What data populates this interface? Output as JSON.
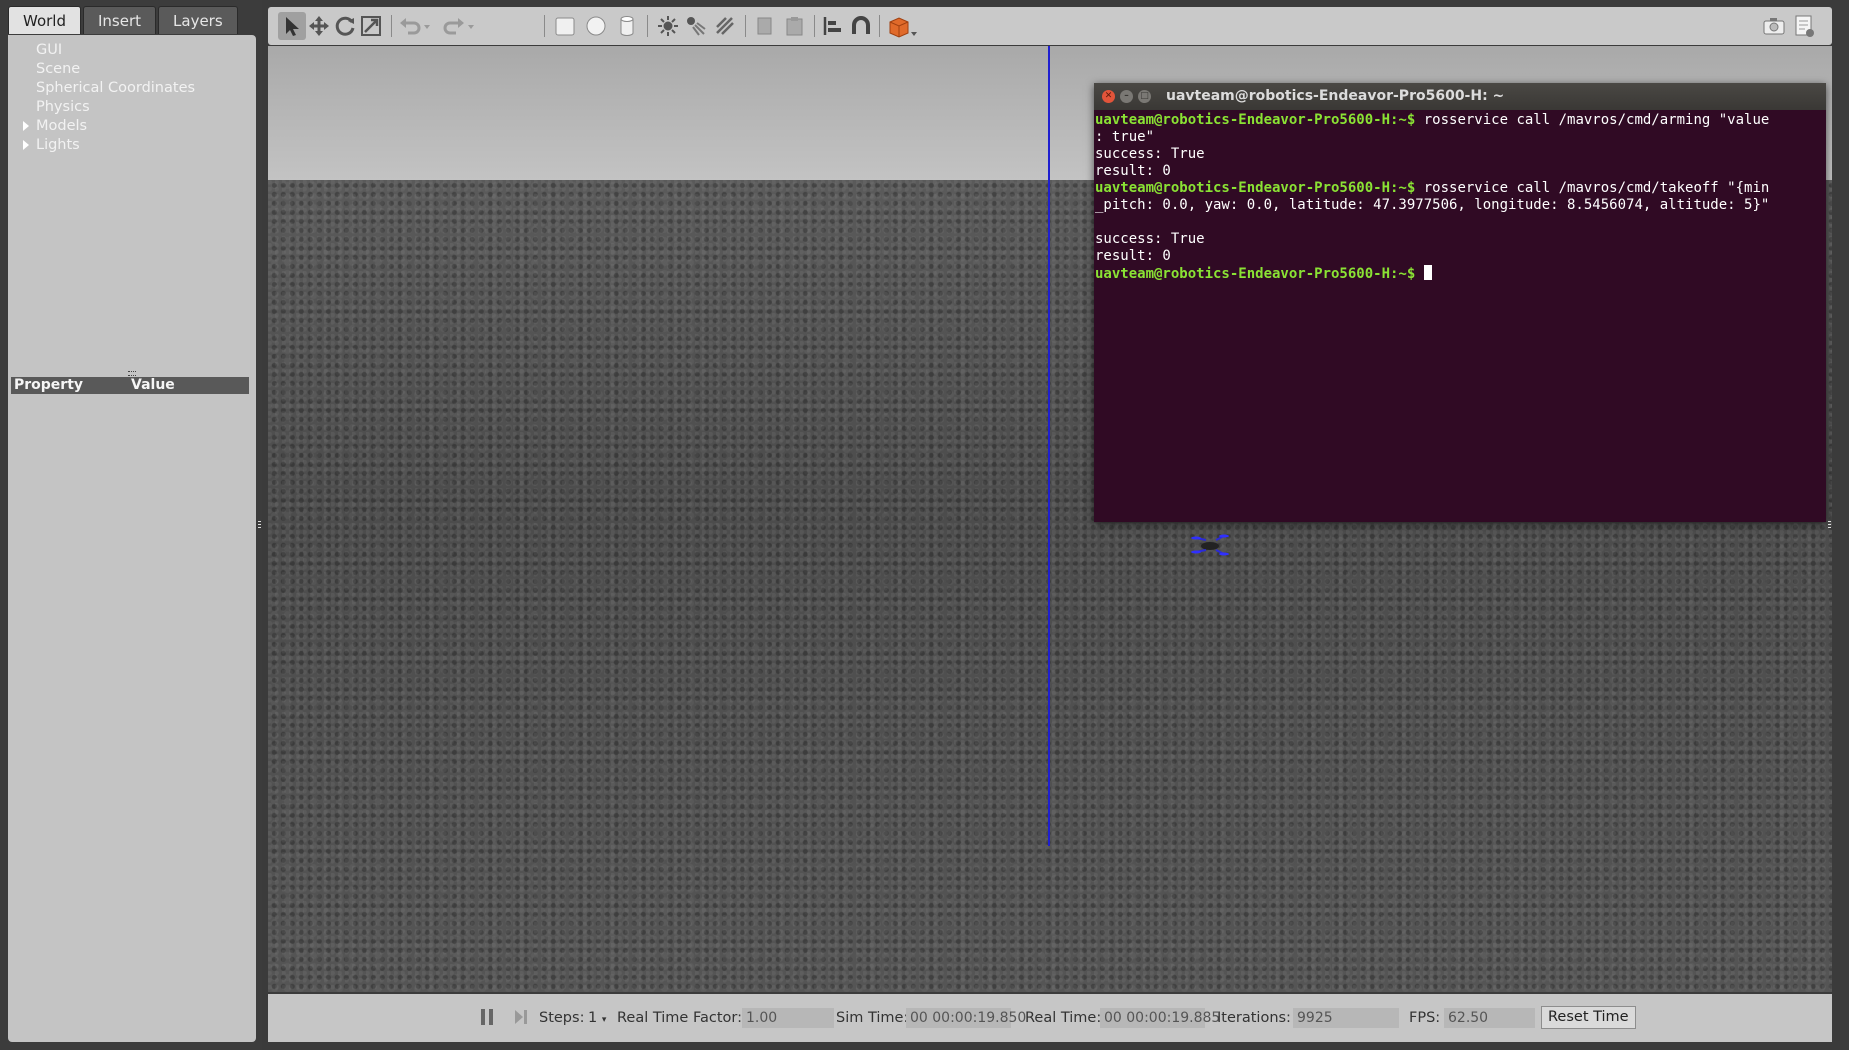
{
  "left_panel": {
    "tabs": [
      {
        "label": "World"
      },
      {
        "label": "Insert"
      },
      {
        "label": "Layers"
      }
    ],
    "tree": [
      {
        "label": "GUI"
      },
      {
        "label": "Scene"
      },
      {
        "label": "Spherical Coordinates"
      },
      {
        "label": "Physics"
      },
      {
        "label": "Models"
      },
      {
        "label": "Lights"
      }
    ],
    "property_header": {
      "property": "Property",
      "value": "Value"
    }
  },
  "toolbar": {
    "icons": [
      "select-arrow-icon",
      "translate-icon",
      "rotate-icon",
      "scale-icon",
      "undo-icon",
      "undo-dropdown-icon",
      "redo-icon",
      "redo-dropdown-icon",
      "box-icon",
      "sphere-icon",
      "cylinder-icon",
      "point-light-icon",
      "spot-light-icon",
      "directional-light-icon",
      "copy-icon",
      "paste-icon",
      "align-icon",
      "snap-icon",
      "view-angle-icon",
      "screenshot-icon",
      "log-icon"
    ]
  },
  "terminal": {
    "title": "uavteam@robotics-Endeavor-Pro5600-H: ~",
    "prompt": "uavteam@robotics-Endeavor-Pro5600-H:~$",
    "lines": [
      {
        "prompt": true,
        "text": " rosservice call /mavros/cmd/arming \"value"
      },
      {
        "prompt": false,
        "text": ": true\""
      },
      {
        "prompt": false,
        "text": "success: True"
      },
      {
        "prompt": false,
        "text": "result: 0"
      },
      {
        "prompt": true,
        "text": " rosservice call /mavros/cmd/takeoff \"{min"
      },
      {
        "prompt": false,
        "text": "_pitch: 0.0, yaw: 0.0, latitude: 47.3977506, longitude: 8.5456074, altitude: 5}\""
      },
      {
        "prompt": false,
        "text": ""
      },
      {
        "prompt": false,
        "text": "success: True"
      },
      {
        "prompt": false,
        "text": "result: 0"
      },
      {
        "prompt": true,
        "text": " ",
        "cursor": true
      }
    ]
  },
  "bottom_bar": {
    "steps_label": "Steps:",
    "steps_value": "1",
    "rtf_label": "Real Time Factor:",
    "rtf_value": "1.00",
    "sim_time_label": "Sim Time:",
    "sim_time_value": "00 00:00:19.850",
    "real_time_label": "Real Time:",
    "real_time_value": "00 00:00:19.885",
    "iterations_label": "Iterations:",
    "iterations_value": "9925",
    "fps_label": "FPS:",
    "fps_value": "62.50",
    "reset_label": "Reset Time"
  },
  "colors": {
    "terminal_bg": "#300a24",
    "prompt": "#8ae234",
    "z_axis": "#1f1fd0"
  }
}
